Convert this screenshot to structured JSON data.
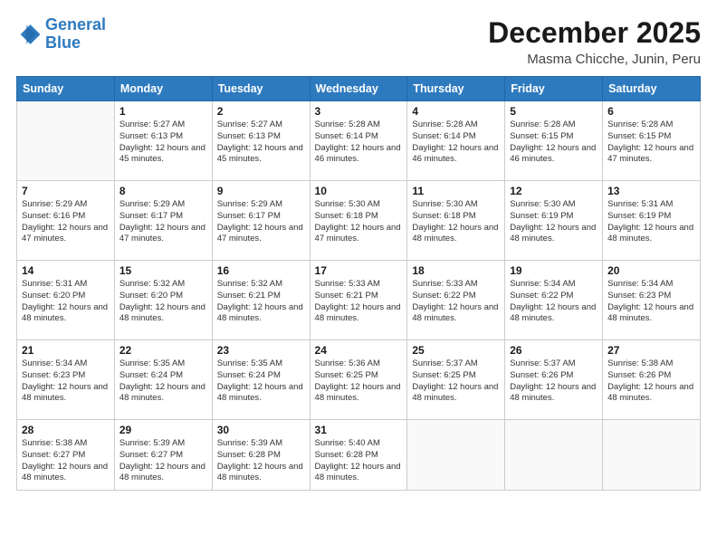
{
  "logo": {
    "line1": "General",
    "line2": "Blue"
  },
  "header": {
    "month": "December 2025",
    "location": "Masma Chicche, Junin, Peru"
  },
  "days": [
    "Sunday",
    "Monday",
    "Tuesday",
    "Wednesday",
    "Thursday",
    "Friday",
    "Saturday"
  ],
  "weeks": [
    [
      {
        "date": "",
        "sunrise": "",
        "sunset": "",
        "daylight": ""
      },
      {
        "date": "1",
        "sunrise": "Sunrise: 5:27 AM",
        "sunset": "Sunset: 6:13 PM",
        "daylight": "Daylight: 12 hours and 45 minutes."
      },
      {
        "date": "2",
        "sunrise": "Sunrise: 5:27 AM",
        "sunset": "Sunset: 6:13 PM",
        "daylight": "Daylight: 12 hours and 45 minutes."
      },
      {
        "date": "3",
        "sunrise": "Sunrise: 5:28 AM",
        "sunset": "Sunset: 6:14 PM",
        "daylight": "Daylight: 12 hours and 46 minutes."
      },
      {
        "date": "4",
        "sunrise": "Sunrise: 5:28 AM",
        "sunset": "Sunset: 6:14 PM",
        "daylight": "Daylight: 12 hours and 46 minutes."
      },
      {
        "date": "5",
        "sunrise": "Sunrise: 5:28 AM",
        "sunset": "Sunset: 6:15 PM",
        "daylight": "Daylight: 12 hours and 46 minutes."
      },
      {
        "date": "6",
        "sunrise": "Sunrise: 5:28 AM",
        "sunset": "Sunset: 6:15 PM",
        "daylight": "Daylight: 12 hours and 47 minutes."
      }
    ],
    [
      {
        "date": "7",
        "sunrise": "Sunrise: 5:29 AM",
        "sunset": "Sunset: 6:16 PM",
        "daylight": "Daylight: 12 hours and 47 minutes."
      },
      {
        "date": "8",
        "sunrise": "Sunrise: 5:29 AM",
        "sunset": "Sunset: 6:17 PM",
        "daylight": "Daylight: 12 hours and 47 minutes."
      },
      {
        "date": "9",
        "sunrise": "Sunrise: 5:29 AM",
        "sunset": "Sunset: 6:17 PM",
        "daylight": "Daylight: 12 hours and 47 minutes."
      },
      {
        "date": "10",
        "sunrise": "Sunrise: 5:30 AM",
        "sunset": "Sunset: 6:18 PM",
        "daylight": "Daylight: 12 hours and 47 minutes."
      },
      {
        "date": "11",
        "sunrise": "Sunrise: 5:30 AM",
        "sunset": "Sunset: 6:18 PM",
        "daylight": "Daylight: 12 hours and 48 minutes."
      },
      {
        "date": "12",
        "sunrise": "Sunrise: 5:30 AM",
        "sunset": "Sunset: 6:19 PM",
        "daylight": "Daylight: 12 hours and 48 minutes."
      },
      {
        "date": "13",
        "sunrise": "Sunrise: 5:31 AM",
        "sunset": "Sunset: 6:19 PM",
        "daylight": "Daylight: 12 hours and 48 minutes."
      }
    ],
    [
      {
        "date": "14",
        "sunrise": "Sunrise: 5:31 AM",
        "sunset": "Sunset: 6:20 PM",
        "daylight": "Daylight: 12 hours and 48 minutes."
      },
      {
        "date": "15",
        "sunrise": "Sunrise: 5:32 AM",
        "sunset": "Sunset: 6:20 PM",
        "daylight": "Daylight: 12 hours and 48 minutes."
      },
      {
        "date": "16",
        "sunrise": "Sunrise: 5:32 AM",
        "sunset": "Sunset: 6:21 PM",
        "daylight": "Daylight: 12 hours and 48 minutes."
      },
      {
        "date": "17",
        "sunrise": "Sunrise: 5:33 AM",
        "sunset": "Sunset: 6:21 PM",
        "daylight": "Daylight: 12 hours and 48 minutes."
      },
      {
        "date": "18",
        "sunrise": "Sunrise: 5:33 AM",
        "sunset": "Sunset: 6:22 PM",
        "daylight": "Daylight: 12 hours and 48 minutes."
      },
      {
        "date": "19",
        "sunrise": "Sunrise: 5:34 AM",
        "sunset": "Sunset: 6:22 PM",
        "daylight": "Daylight: 12 hours and 48 minutes."
      },
      {
        "date": "20",
        "sunrise": "Sunrise: 5:34 AM",
        "sunset": "Sunset: 6:23 PM",
        "daylight": "Daylight: 12 hours and 48 minutes."
      }
    ],
    [
      {
        "date": "21",
        "sunrise": "Sunrise: 5:34 AM",
        "sunset": "Sunset: 6:23 PM",
        "daylight": "Daylight: 12 hours and 48 minutes."
      },
      {
        "date": "22",
        "sunrise": "Sunrise: 5:35 AM",
        "sunset": "Sunset: 6:24 PM",
        "daylight": "Daylight: 12 hours and 48 minutes."
      },
      {
        "date": "23",
        "sunrise": "Sunrise: 5:35 AM",
        "sunset": "Sunset: 6:24 PM",
        "daylight": "Daylight: 12 hours and 48 minutes."
      },
      {
        "date": "24",
        "sunrise": "Sunrise: 5:36 AM",
        "sunset": "Sunset: 6:25 PM",
        "daylight": "Daylight: 12 hours and 48 minutes."
      },
      {
        "date": "25",
        "sunrise": "Sunrise: 5:37 AM",
        "sunset": "Sunset: 6:25 PM",
        "daylight": "Daylight: 12 hours and 48 minutes."
      },
      {
        "date": "26",
        "sunrise": "Sunrise: 5:37 AM",
        "sunset": "Sunset: 6:26 PM",
        "daylight": "Daylight: 12 hours and 48 minutes."
      },
      {
        "date": "27",
        "sunrise": "Sunrise: 5:38 AM",
        "sunset": "Sunset: 6:26 PM",
        "daylight": "Daylight: 12 hours and 48 minutes."
      }
    ],
    [
      {
        "date": "28",
        "sunrise": "Sunrise: 5:38 AM",
        "sunset": "Sunset: 6:27 PM",
        "daylight": "Daylight: 12 hours and 48 minutes."
      },
      {
        "date": "29",
        "sunrise": "Sunrise: 5:39 AM",
        "sunset": "Sunset: 6:27 PM",
        "daylight": "Daylight: 12 hours and 48 minutes."
      },
      {
        "date": "30",
        "sunrise": "Sunrise: 5:39 AM",
        "sunset": "Sunset: 6:28 PM",
        "daylight": "Daylight: 12 hours and 48 minutes."
      },
      {
        "date": "31",
        "sunrise": "Sunrise: 5:40 AM",
        "sunset": "Sunset: 6:28 PM",
        "daylight": "Daylight: 12 hours and 48 minutes."
      },
      {
        "date": "",
        "sunrise": "",
        "sunset": "",
        "daylight": ""
      },
      {
        "date": "",
        "sunrise": "",
        "sunset": "",
        "daylight": ""
      },
      {
        "date": "",
        "sunrise": "",
        "sunset": "",
        "daylight": ""
      }
    ]
  ]
}
